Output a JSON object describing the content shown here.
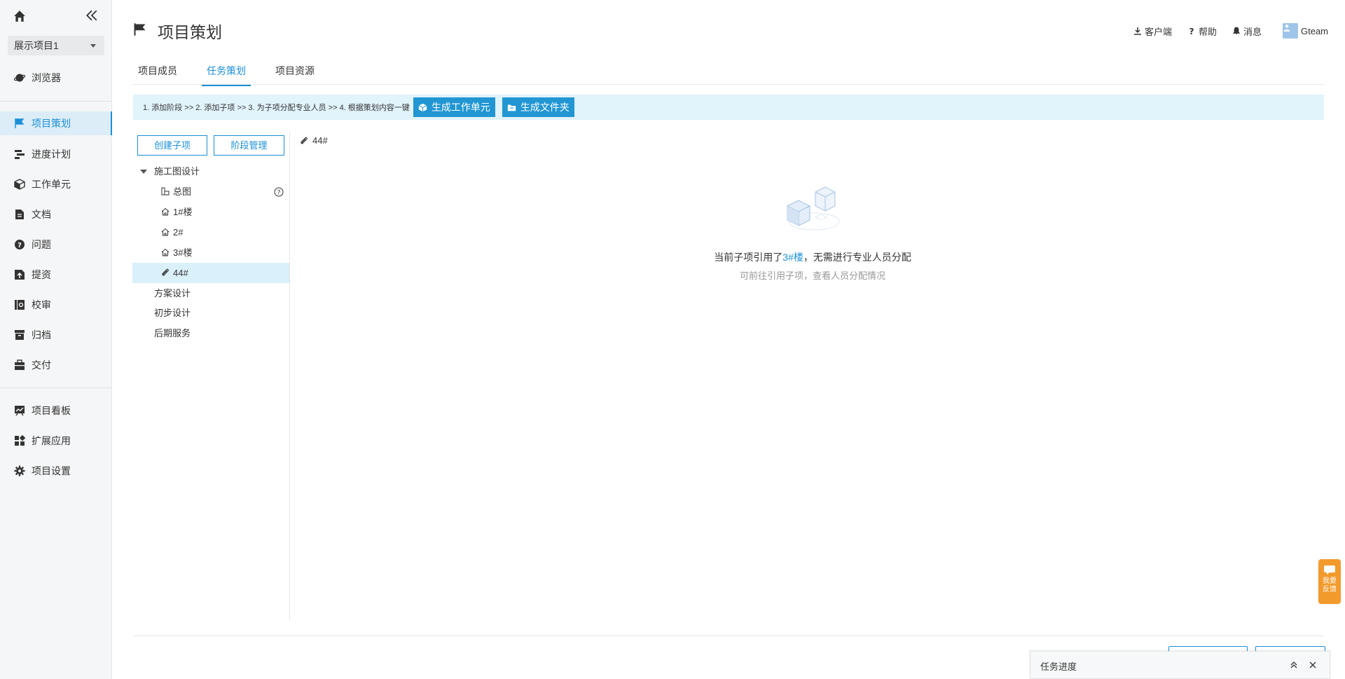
{
  "sidebar": {
    "project_select": "展示项目1",
    "items": [
      {
        "label": "浏览器",
        "icon": "planet-icon"
      },
      {
        "label": "项目策划",
        "icon": "flag-icon",
        "active": true
      },
      {
        "label": "进度计划",
        "icon": "gantt-icon"
      },
      {
        "label": "工作单元",
        "icon": "cube-icon"
      },
      {
        "label": "文档",
        "icon": "document-icon"
      },
      {
        "label": "问题",
        "icon": "question-icon"
      },
      {
        "label": "提资",
        "icon": "upload-doc-icon"
      },
      {
        "label": "校审",
        "icon": "review-icon"
      },
      {
        "label": "归档",
        "icon": "archive-icon"
      },
      {
        "label": "交付",
        "icon": "briefcase-icon"
      },
      {
        "label": "项目看板",
        "icon": "dashboard-icon"
      },
      {
        "label": "扩展应用",
        "icon": "apps-icon"
      },
      {
        "label": "项目设置",
        "icon": "gear-icon"
      }
    ]
  },
  "header": {
    "title": "项目策划",
    "links": {
      "client": "客户端",
      "help": "帮助",
      "messages": "消息",
      "user": "Gteam"
    }
  },
  "tabs": [
    "项目成员",
    "任务策划",
    "项目资源"
  ],
  "steps": {
    "text": "1. 添加阶段  >>  2. 添加子项  >>  3. 为子项分配专业人员  >>  4. 根据策划内容一键",
    "btn_work_unit": "生成工作单元",
    "btn_folder": "生成文件夹"
  },
  "tree": {
    "create_btn": "创建子项",
    "stage_btn": "阶段管理",
    "stage1": "施工图设计",
    "children": [
      "总图",
      "1#楼",
      "2#",
      "3#楼",
      "44#"
    ],
    "stage2": "方案设计",
    "stage3": "初步设计",
    "stage4": "后期服务"
  },
  "content": {
    "crumb": "44#",
    "msg_prefix": "当前子项引用了",
    "msg_link": "3#楼",
    "msg_suffix": "，无需进行专业人员分配",
    "sub": "可前往引用子项，查看人员分配情况"
  },
  "task_progress": {
    "label": "任务进度"
  },
  "feedback": {
    "line1": "我要",
    "line2": "反馈"
  },
  "colors": {
    "accent": "#1a8fd8",
    "banner": "#e1f3fb",
    "feedback": "#f39a2c"
  }
}
